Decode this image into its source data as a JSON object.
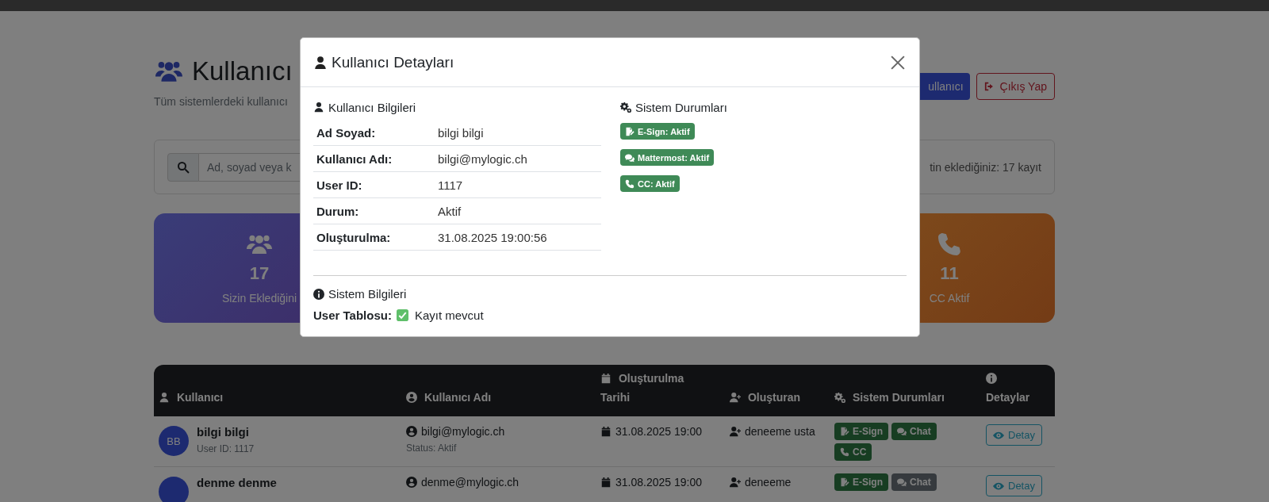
{
  "header": {
    "title": "Kullanıcı",
    "subtitle": "Tüm sistemlerdeki kullanıcı",
    "add_button": "ullanıcı",
    "logout_button": "Çıkış Yap"
  },
  "search": {
    "placeholder": "Ad, soyad veya k",
    "summary": "tin eklediğiniz: 17 kayıt"
  },
  "stats": [
    {
      "kind": "users",
      "value": "17",
      "label": "Sizin Eklediğini"
    },
    {
      "kind": "phone",
      "value": "11",
      "label": "CC Aktif"
    }
  ],
  "table": {
    "columns": [
      {
        "kind": "user",
        "label": "Kullanıcı"
      },
      {
        "kind": "user-circle",
        "label": "Kullanıcı Adı"
      },
      {
        "kind": "calendar",
        "label": "Oluşturulma Tarihi"
      },
      {
        "kind": "user-plus",
        "label": "Oluşturan"
      },
      {
        "kind": "gears",
        "label": "Sistem Durumları"
      },
      {
        "kind": "info",
        "label": "Detaylar"
      }
    ],
    "rows": [
      {
        "initials": "BB",
        "name": "bilgi bilgi",
        "sub": "User ID: 1117",
        "username": "bilgi@mylogic.ch",
        "status": "Status: Aktif",
        "date": "31.08.2025 19:00",
        "creator": "deneeme usta",
        "systems": [
          {
            "kind": "esign",
            "label": "E-Sign",
            "active": true
          },
          {
            "kind": "chat",
            "label": "Chat",
            "active": true
          },
          {
            "kind": "phone",
            "label": "CC",
            "active": true
          }
        ],
        "action": "Detay"
      },
      {
        "name": "denme denme",
        "username": "denme@mylogic.ch",
        "date": "31.08.2025 19:00",
        "creator": "deneeme",
        "systems": [
          {
            "kind": "esign",
            "label": "E-Sign",
            "active": true
          },
          {
            "kind": "chat",
            "label": "Chat",
            "active": false
          }
        ],
        "action": "Detay"
      }
    ]
  },
  "modal": {
    "title": "Kullanıcı Detayları",
    "user_section": {
      "title": "Kullanıcı Bilgileri",
      "rows": [
        {
          "label": "Ad Soyad:",
          "value": "bilgi bilgi"
        },
        {
          "label": "Kullanıcı Adı:",
          "value": "bilgi@mylogic.ch"
        },
        {
          "label": "User ID:",
          "value": "1117"
        },
        {
          "label": "Durum:",
          "value": "Aktif"
        },
        {
          "label": "Oluşturulma:",
          "value": "31.08.2025 19:00:56"
        }
      ]
    },
    "systems_section": {
      "title": "Sistem Durumları",
      "badges": [
        {
          "kind": "esign",
          "label": "E-Sign: Aktif"
        },
        {
          "kind": "chat",
          "label": "Mattermost: Aktif"
        },
        {
          "kind": "phone",
          "label": "CC: Aktif"
        }
      ]
    },
    "info_section": {
      "title": "Sistem Bilgileri",
      "label": "User Tablosu:",
      "checked": true,
      "value": "Kayıt mevcut"
    }
  }
}
